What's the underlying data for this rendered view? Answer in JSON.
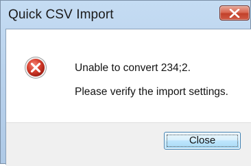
{
  "window": {
    "title": "Quick CSV Import"
  },
  "dialog": {
    "icon": "error-icon",
    "message_line1": "Unable to convert 234;2.",
    "message_line2": "Please verify the import settings.",
    "close_button_label": "Close"
  },
  "colors": {
    "error_red": "#c9302c",
    "titlebar": "#b9d2ec",
    "button_border": "#3c7fb1"
  }
}
